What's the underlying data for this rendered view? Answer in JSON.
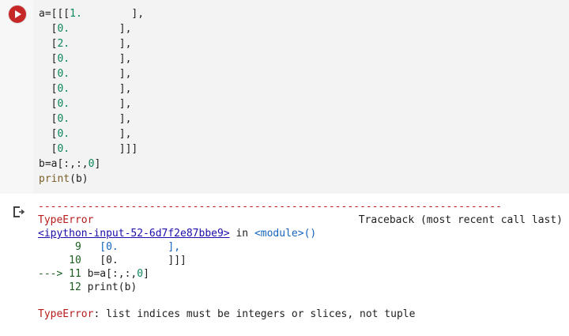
{
  "cell": {
    "run_button_icon": "play-icon",
    "lines": {
      "l1_prefix": "a=[[[",
      "l1_num": "1.",
      "l1_suffix": "        ],",
      "rows_mid": [
        {
          "open": "  [",
          "num": "0.",
          "close": "        ],"
        },
        {
          "open": "  [",
          "num": "2.",
          "close": "        ],"
        },
        {
          "open": "  [",
          "num": "0.",
          "close": "        ],"
        },
        {
          "open": "  [",
          "num": "0.",
          "close": "        ],"
        },
        {
          "open": "  [",
          "num": "0.",
          "close": "        ],"
        },
        {
          "open": "  [",
          "num": "0.",
          "close": "        ],"
        },
        {
          "open": "  [",
          "num": "0.",
          "close": "        ],"
        },
        {
          "open": "  [",
          "num": "0.",
          "close": "        ],"
        },
        {
          "open": "  [",
          "num": "0.",
          "close": "        ]]]"
        }
      ],
      "b_line_prefix": "b=a[:,:,",
      "b_line_num": "0",
      "b_line_suffix": "]",
      "print_fn": "print",
      "print_args": "(b)"
    }
  },
  "output": {
    "icon": "output-icon",
    "dashes": "---------------------------------------------------------------------------",
    "error_type": "TypeError",
    "traceback_label": "Traceback (most recent call last)",
    "input_link": "<ipython-input-52-6d7f2e87bbe9>",
    "in_text": " in ",
    "module_text": "<module>()",
    "frames": [
      {
        "num": "      9",
        "code": "   [0.        ],"
      },
      {
        "num": "     10",
        "code": "   [0.        ]]]"
      }
    ],
    "arrow": "---> 11",
    "arrow_code_prefix": " b=a[:,:,",
    "arrow_code_num": "0",
    "arrow_code_suffix": "]",
    "line12_num": "     12",
    "line12_code": " print(b)",
    "final_error_type": "TypeError",
    "final_error_msg": ": list indices must be integers or slices, not tuple"
  }
}
